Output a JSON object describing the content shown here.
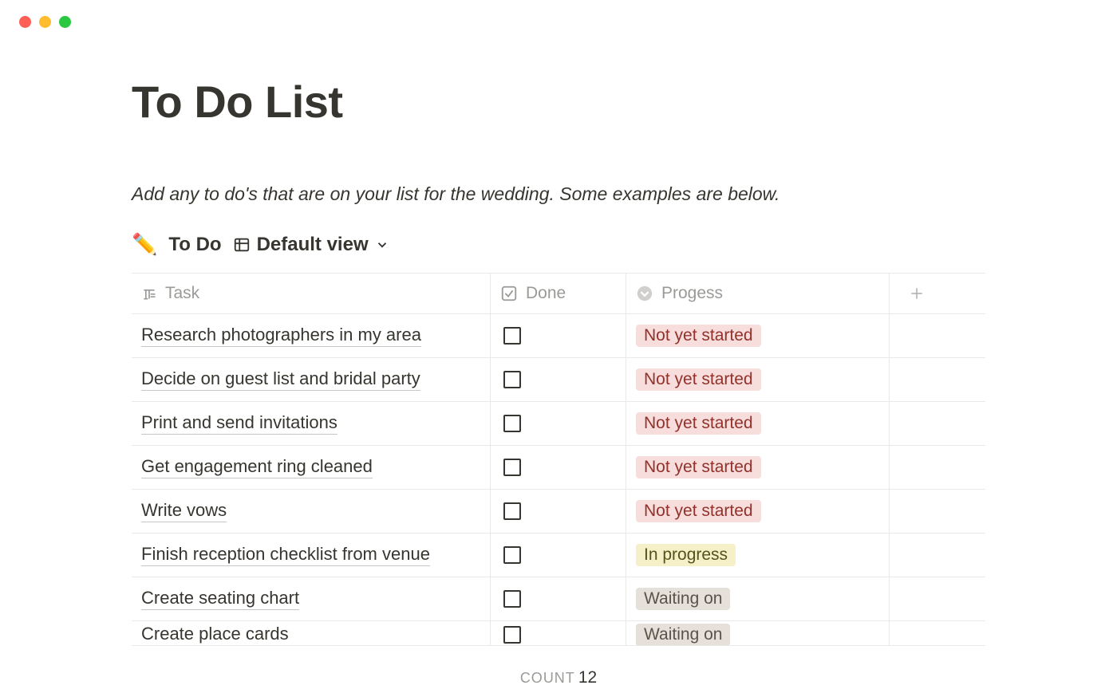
{
  "page": {
    "title": "To Do List",
    "description": "Add any to do's that are on your list for the wedding. Some examples are below."
  },
  "database": {
    "icon": "✏️",
    "name": "To Do",
    "view_label": "Default view"
  },
  "columns": {
    "task": "Task",
    "done": "Done",
    "progress": "Progess"
  },
  "rows": [
    {
      "task": "Research photographers in my area",
      "done": false,
      "progress": "Not yet started",
      "progress_key": "not_started"
    },
    {
      "task": "Decide on guest list and bridal party",
      "done": false,
      "progress": "Not yet started",
      "progress_key": "not_started"
    },
    {
      "task": "Print and send invitations",
      "done": false,
      "progress": "Not yet started",
      "progress_key": "not_started"
    },
    {
      "task": "Get engagement ring cleaned",
      "done": false,
      "progress": "Not yet started",
      "progress_key": "not_started"
    },
    {
      "task": "Write vows",
      "done": false,
      "progress": "Not yet started",
      "progress_key": "not_started"
    },
    {
      "task": "Finish reception checklist from venue",
      "done": false,
      "progress": "In progress",
      "progress_key": "in_progress"
    },
    {
      "task": "Create seating chart",
      "done": false,
      "progress": "Waiting on",
      "progress_key": "waiting"
    },
    {
      "task": "Create place cards",
      "done": false,
      "progress": "Waiting on",
      "progress_key": "waiting"
    }
  ],
  "footer": {
    "count_label": "COUNT",
    "count_value": "12"
  },
  "tag_classes": {
    "not_started": "tag-not-started",
    "in_progress": "tag-in-progress",
    "waiting": "tag-waiting"
  }
}
